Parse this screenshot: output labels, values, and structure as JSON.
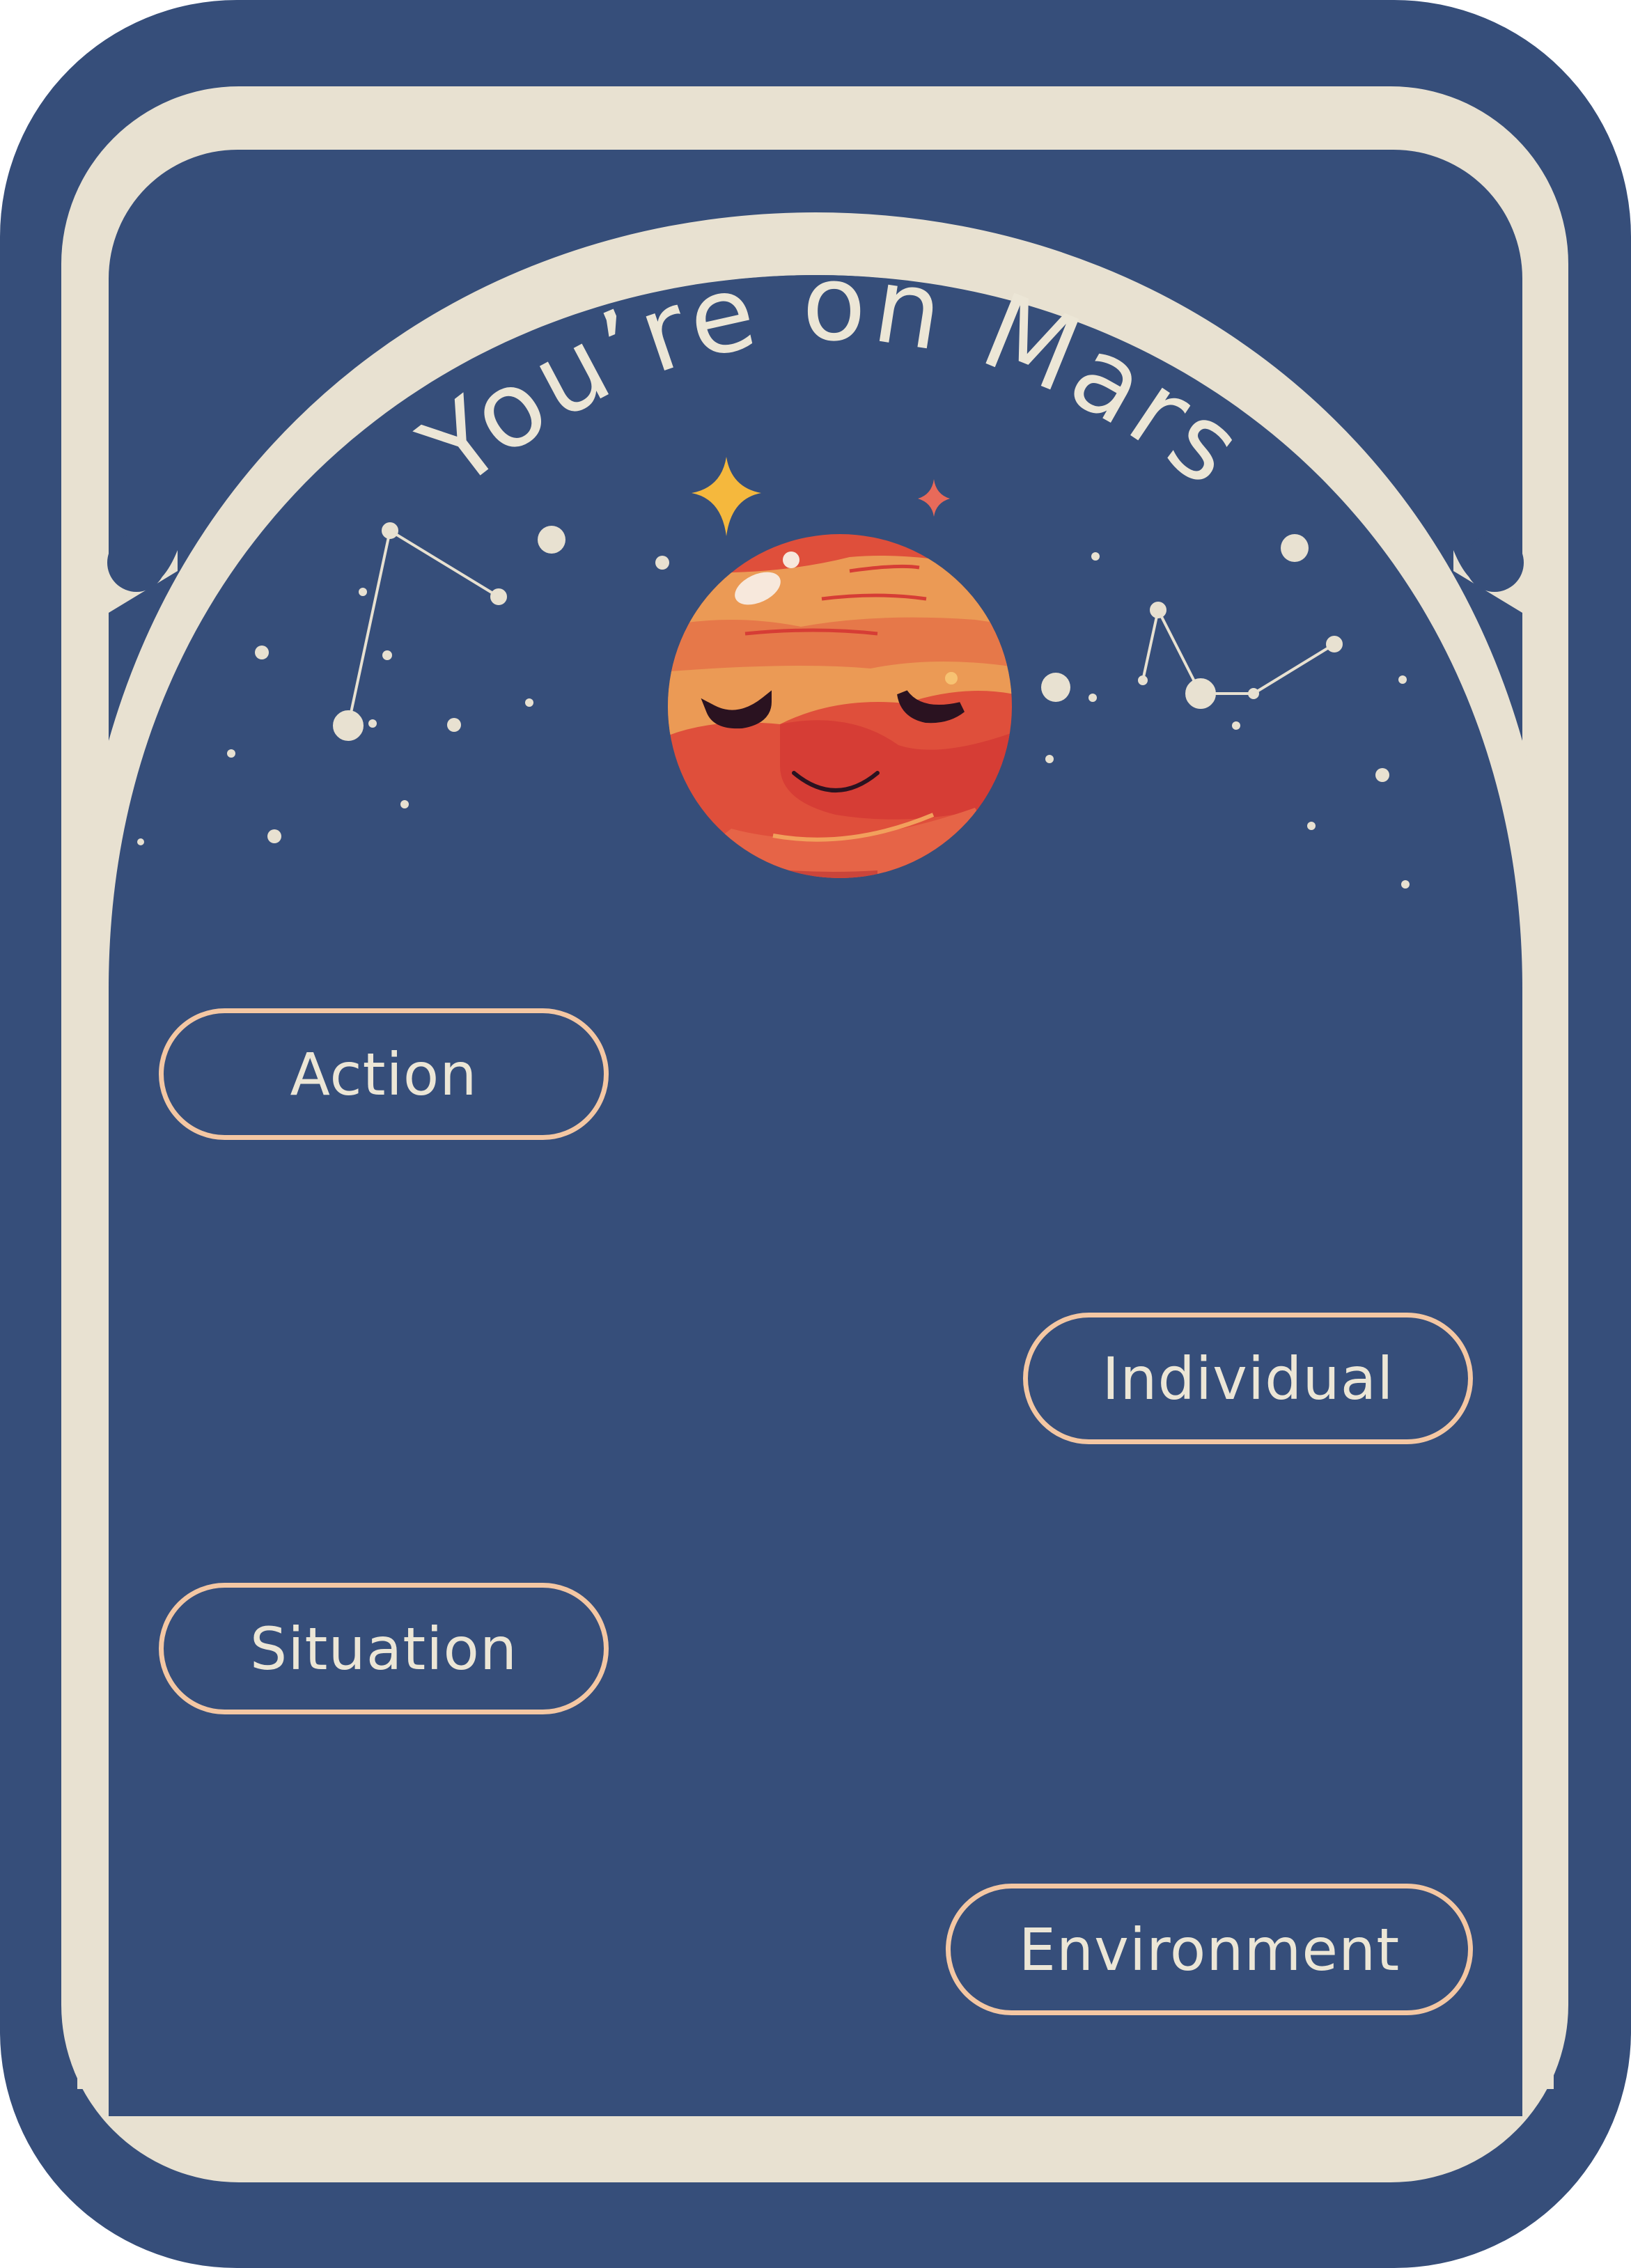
{
  "card": {
    "title": "You’re on Mars",
    "colors": {
      "navy": "#364e7a",
      "cream": "#e8e1d1",
      "tag_border": "#f4c7a3",
      "planet_orange": "#eb9a55",
      "planet_red": "#df4f3b"
    },
    "decorations": [
      "planet-mars-icon",
      "sparkle-star-icon",
      "constellation-icon"
    ]
  },
  "tags": {
    "action": "Action",
    "individual": "Individual",
    "situation": "Situation",
    "environment": "Environment"
  }
}
